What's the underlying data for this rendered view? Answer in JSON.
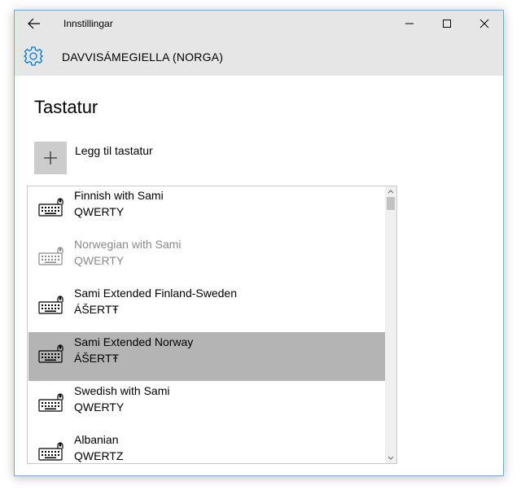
{
  "window": {
    "title": "Innstillingar",
    "accent": "#0078d7"
  },
  "header": {
    "title": "DAVVISÁMEGIELLA (NORGA)",
    "icon": "gear-icon"
  },
  "page": {
    "title": "Tastatur",
    "add_label": "Legg til tastatur"
  },
  "keyboards": [
    {
      "name": "Finnish with Sami",
      "layout": "QWERTY",
      "state": "normal"
    },
    {
      "name": "Norwegian with Sami",
      "layout": "QWERTY",
      "state": "disabled"
    },
    {
      "name": "Sami Extended Finland-Sweden",
      "layout": "ÁŠERTŦ",
      "state": "normal"
    },
    {
      "name": "Sami Extended Norway",
      "layout": "ÁŠERTŦ",
      "state": "selected"
    },
    {
      "name": "Swedish with Sami",
      "layout": "QWERTY",
      "state": "normal"
    },
    {
      "name": "Albanian",
      "layout": "QWERTZ",
      "state": "normal"
    }
  ]
}
